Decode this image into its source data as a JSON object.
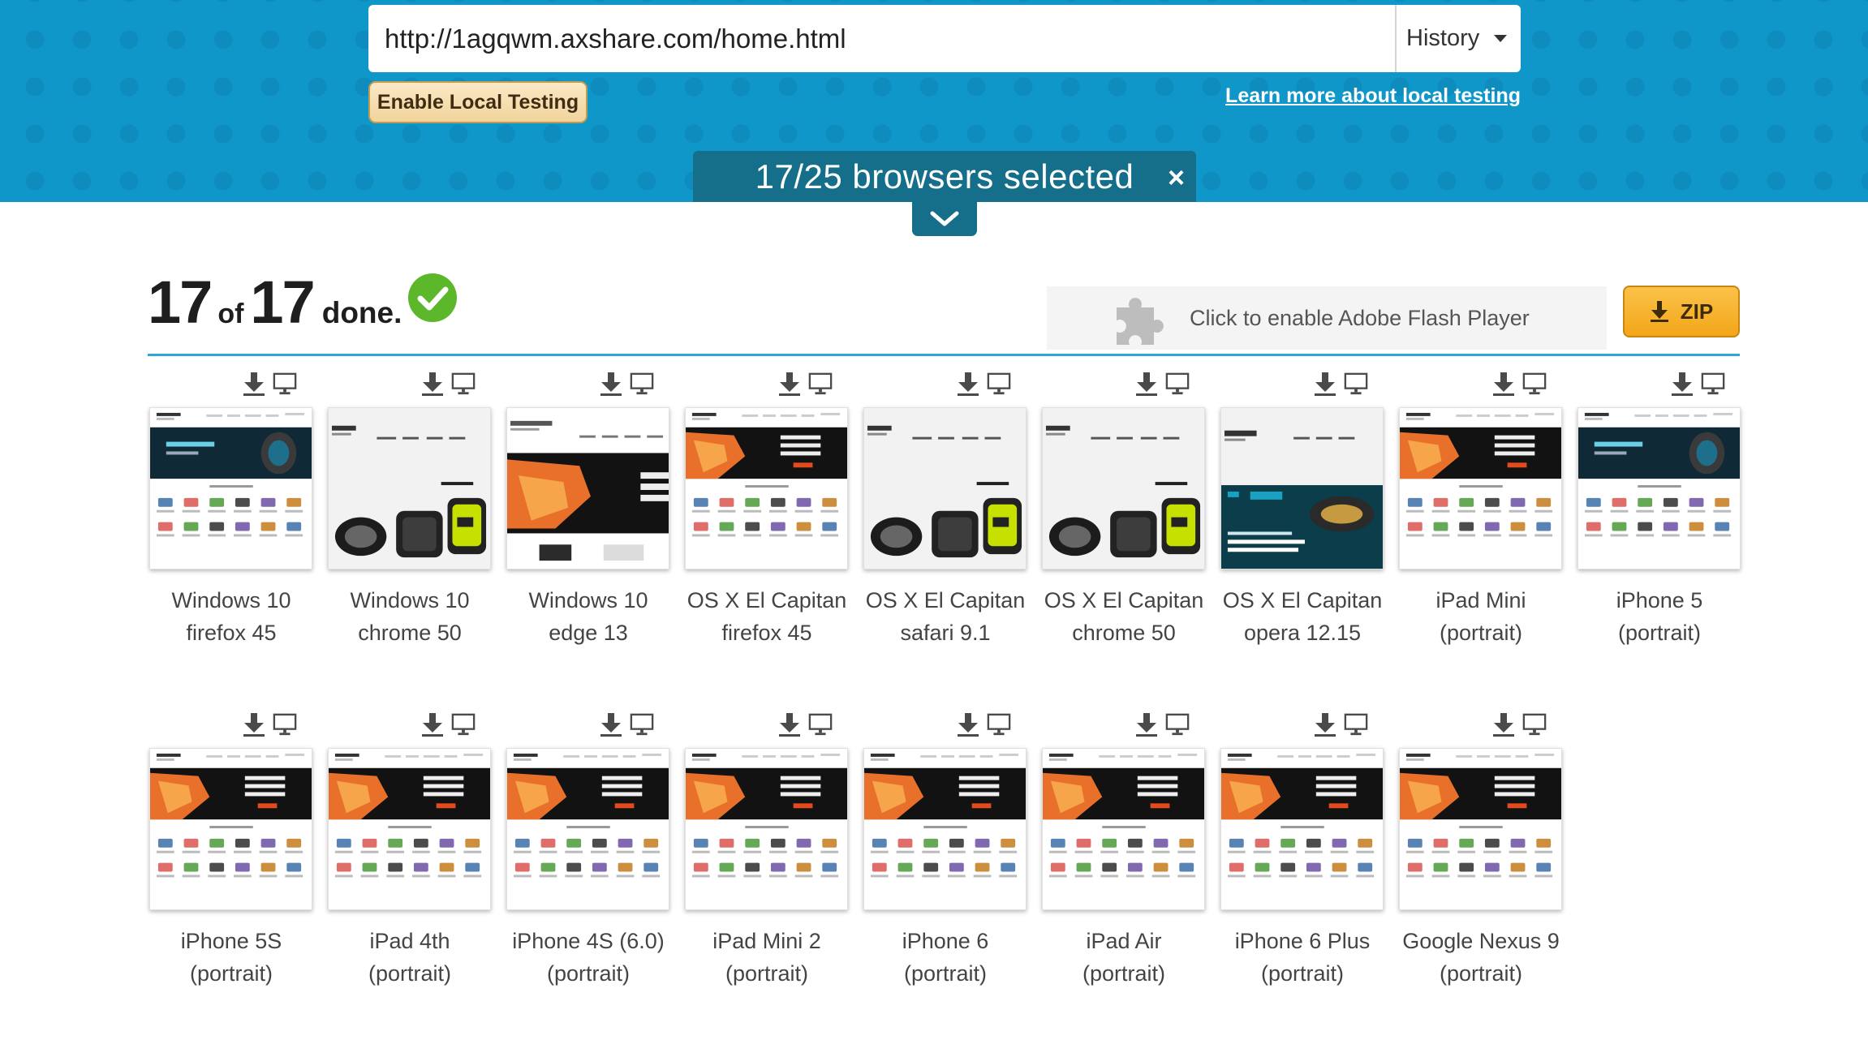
{
  "header": {
    "url": "http://1agqwm.axshare.com/home.html",
    "history_label": "History",
    "enable_local_label": "Enable Local Testing",
    "learn_more_label": "Learn more about local testing",
    "browsers_selected": "17/25 browsers selected",
    "close_glyph": "×"
  },
  "status": {
    "done_count": "17",
    "of_word": "of",
    "total": "17",
    "done_word": "done."
  },
  "flash": {
    "label": "Click to enable Adobe Flash Player"
  },
  "zip": {
    "label": "ZIP"
  },
  "colors": {
    "header_bg": "#1097c9",
    "bar_bg": "#156e8a",
    "accent_line": "#2ea6d6",
    "zip_bg": "#f3a619",
    "check_green": "#5cb82a"
  },
  "icons": {
    "download": "download-icon",
    "view": "monitor-icon",
    "check": "check-circle-icon",
    "puzzle": "puzzle-icon",
    "chevron": "chevron-down-icon"
  },
  "screenshots": [
    {
      "line1": "Windows 10",
      "line2": "firefox 45",
      "thumb": "desktop-dark"
    },
    {
      "line1": "Windows 10",
      "line2": "chrome 50",
      "thumb": "desktop-watch"
    },
    {
      "line1": "Windows 10",
      "line2": "edge 13",
      "thumb": "desktop-edge"
    },
    {
      "line1": "OS X El Capitan",
      "line2": "firefox 45",
      "thumb": "mobile"
    },
    {
      "line1": "OS X El Capitan",
      "line2": "safari 9.1",
      "thumb": "desktop-watch"
    },
    {
      "line1": "OS X El Capitan",
      "line2": "chrome 50",
      "thumb": "desktop-watch"
    },
    {
      "line1": "OS X El Capitan",
      "line2": "opera 12.15",
      "thumb": "desktop-teal"
    },
    {
      "line1": "iPad Mini",
      "line2": "(portrait)",
      "thumb": "mobile"
    },
    {
      "line1": "iPhone 5",
      "line2": "(portrait)",
      "thumb": "desktop-dark"
    },
    {
      "line1": "iPhone 5S",
      "line2": "(portrait)",
      "thumb": "mobile"
    },
    {
      "line1": "iPad 4th",
      "line2": "(portrait)",
      "thumb": "mobile"
    },
    {
      "line1": "iPhone 4S (6.0)",
      "line2": "(portrait)",
      "thumb": "mobile"
    },
    {
      "line1": "iPad Mini 2",
      "line2": "(portrait)",
      "thumb": "mobile"
    },
    {
      "line1": "iPhone 6",
      "line2": "(portrait)",
      "thumb": "mobile"
    },
    {
      "line1": "iPad Air",
      "line2": "(portrait)",
      "thumb": "mobile"
    },
    {
      "line1": "iPhone 6 Plus",
      "line2": "(portrait)",
      "thumb": "mobile"
    },
    {
      "line1": "Google Nexus 9",
      "line2": "(portrait)",
      "thumb": "mobile"
    }
  ]
}
